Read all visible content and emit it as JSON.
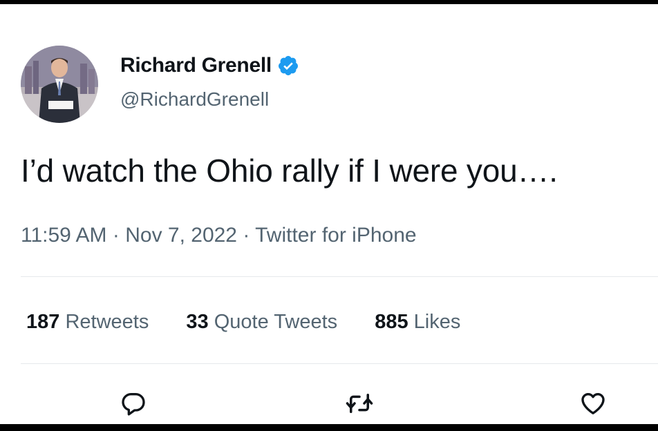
{
  "author": {
    "display_name": "Richard Grenell",
    "handle": "@RichardGrenell",
    "verified_icon": "verified-badge-icon",
    "verified_color": "#1d9bf0"
  },
  "tweet": {
    "text": "I’d watch the Ohio rally if I were you…."
  },
  "meta": {
    "time": "11:59 AM",
    "date": "Nov 7, 2022",
    "source": "Twitter for iPhone",
    "separator": "·"
  },
  "stats": {
    "retweets_count": "187",
    "retweets_label": "Retweets",
    "quotes_count": "33",
    "quotes_label": "Quote Tweets",
    "likes_count": "885",
    "likes_label": "Likes"
  },
  "actions": {
    "reply_icon": "reply-icon",
    "retweet_icon": "retweet-icon",
    "like_icon": "heart-icon"
  },
  "colors": {
    "text_primary": "#0f1419",
    "text_secondary": "#536471",
    "divider": "#e6e9eb"
  }
}
